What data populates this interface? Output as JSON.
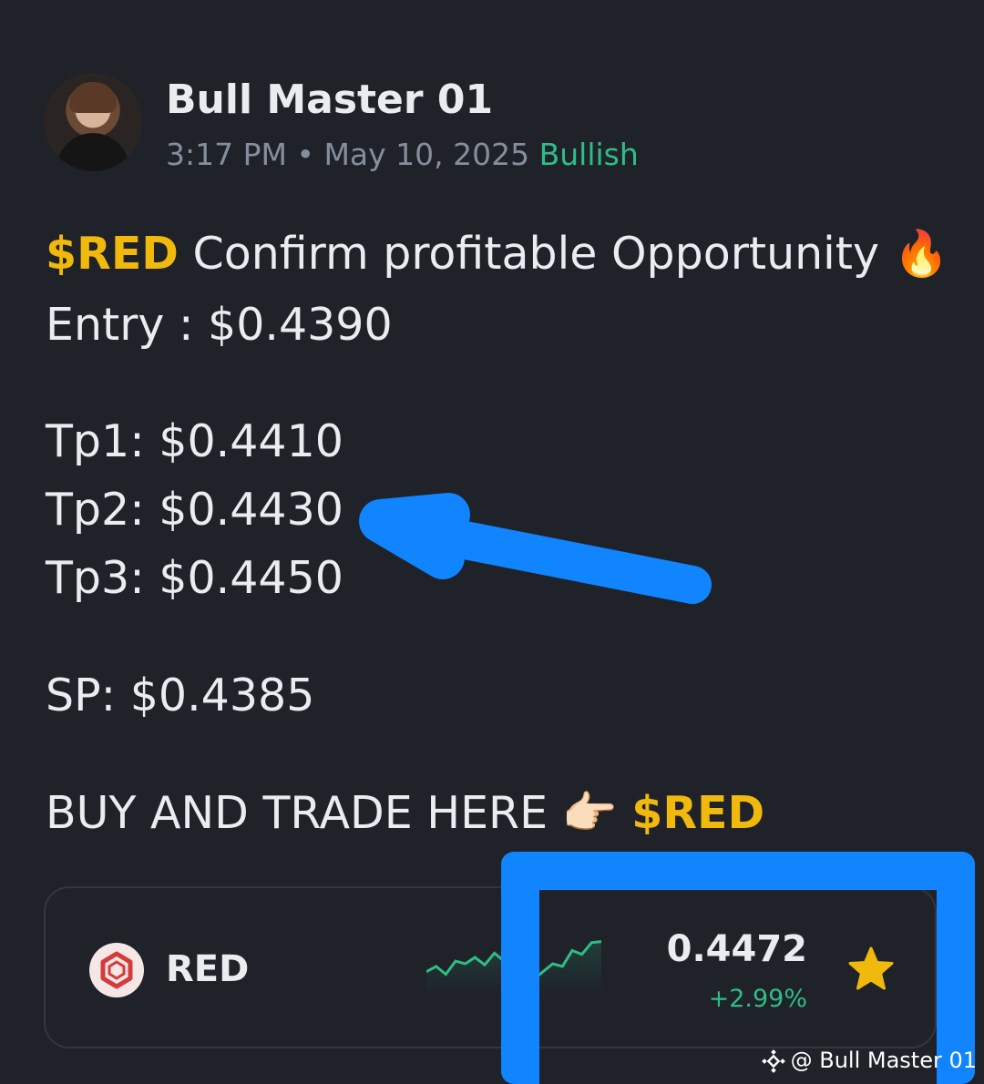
{
  "author": {
    "name": "Bull Master 01",
    "time": "3:17 PM",
    "separator": "•",
    "date": "May 10, 2025",
    "sentiment": "Bullish"
  },
  "post": {
    "line1_ticker": "$RED",
    "line1_text": " Confirm profitable Opportunity ",
    "line1_emoji": "🔥",
    "entry": "Entry : $0.4390",
    "tp1": "Tp1: $0.4410",
    "tp2": "Tp2: $0.4430",
    "tp3": "Tp3: $0.4450",
    "sp": "SP: $0.4385",
    "cta_text": "BUY AND TRADE HERE ",
    "cta_emoji": "👉🏻",
    "cta_ticker": "$RED"
  },
  "coin_card": {
    "symbol": "RED",
    "price": "0.4472",
    "change": "+2.99%",
    "favorite_icon": "star-icon",
    "logo_icon": "red-coin-logo-icon",
    "sparkline": [
      0.35,
      0.45,
      0.3,
      0.55,
      0.5,
      0.62,
      0.48,
      0.7,
      0.55,
      0.3,
      0.45,
      0.2,
      0.35,
      0.5,
      0.45,
      0.75,
      0.68,
      0.9,
      0.92
    ]
  },
  "watermark": {
    "text": "@ Bull Master 01",
    "icon": "binance-square-icon"
  },
  "colors": {
    "background": "#1f2229",
    "ticker": "#f0b90b",
    "bullish": "#2ebd85",
    "annotation": "#1184ff",
    "muted": "#848e9c"
  }
}
